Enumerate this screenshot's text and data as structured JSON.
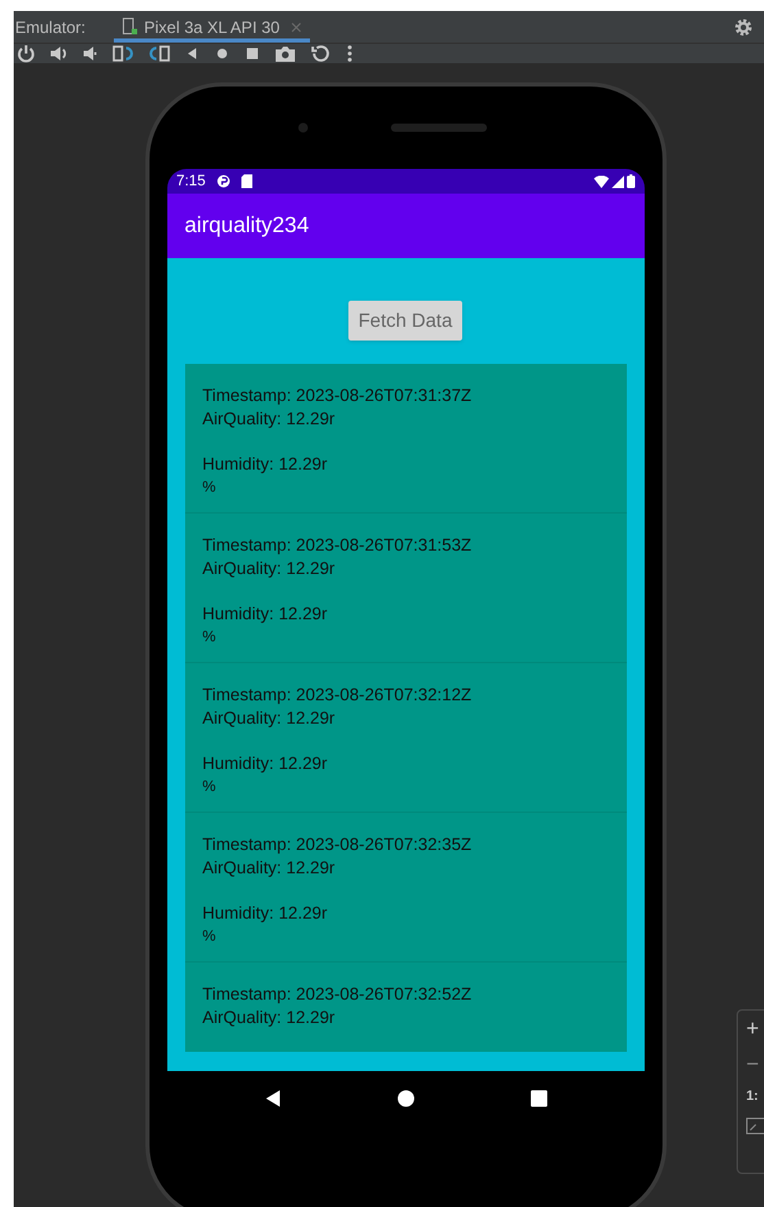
{
  "tool_window": {
    "title": "Emulator:",
    "tabs": [
      {
        "label": "Pixel 3a XL API 30",
        "selected": true
      }
    ]
  },
  "status_bar": {
    "time": "7:15"
  },
  "app_bar": {
    "title": "airquality234"
  },
  "fetch_button": {
    "label": "Fetch Data"
  },
  "readings": [
    {
      "timestamp": "Timestamp: 2023-08-26T07:31:37Z",
      "air_quality": "AirQuality: 12.29r",
      "humidity": "Humidity: 12.29r",
      "unit": "%"
    },
    {
      "timestamp": "Timestamp: 2023-08-26T07:31:53Z",
      "air_quality": "AirQuality: 12.29r",
      "humidity": "Humidity: 12.29r",
      "unit": "%"
    },
    {
      "timestamp": "Timestamp: 2023-08-26T07:32:12Z",
      "air_quality": "AirQuality: 12.29r",
      "humidity": "Humidity: 12.29r",
      "unit": "%"
    },
    {
      "timestamp": "Timestamp: 2023-08-26T07:32:35Z",
      "air_quality": "AirQuality: 12.29r",
      "humidity": "Humidity: 12.29r",
      "unit": "%"
    },
    {
      "timestamp": "Timestamp: 2023-08-26T07:32:52Z",
      "air_quality": "AirQuality: 12.29r"
    }
  ],
  "zoom_controls": {
    "plus": "+",
    "minus": "−",
    "actual_size": "1:"
  }
}
